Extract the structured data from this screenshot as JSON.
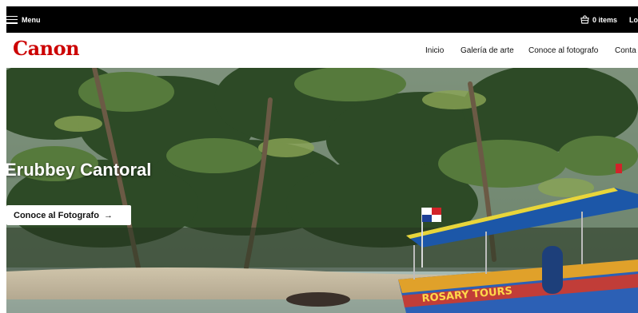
{
  "topbar": {
    "menu_label": "Menu",
    "cart_label": "0 items",
    "login_label": "Lo"
  },
  "header": {
    "logo_text": "Canon",
    "nav": [
      "Inicio",
      "Galería de arte",
      "Conoce al fotografo",
      "Conta"
    ]
  },
  "hero": {
    "title": "Erubbey Cantoral",
    "cta_label": "Conoce al Fotografo",
    "cta_arrow": "→",
    "boat_text": "ROSARY TOURS"
  },
  "colors": {
    "brand": "#cc0000",
    "topbar_bg": "#000000"
  },
  "icons": [
    "hamburger-icon",
    "shopping-bag-icon",
    "arrow-right-icon"
  ]
}
